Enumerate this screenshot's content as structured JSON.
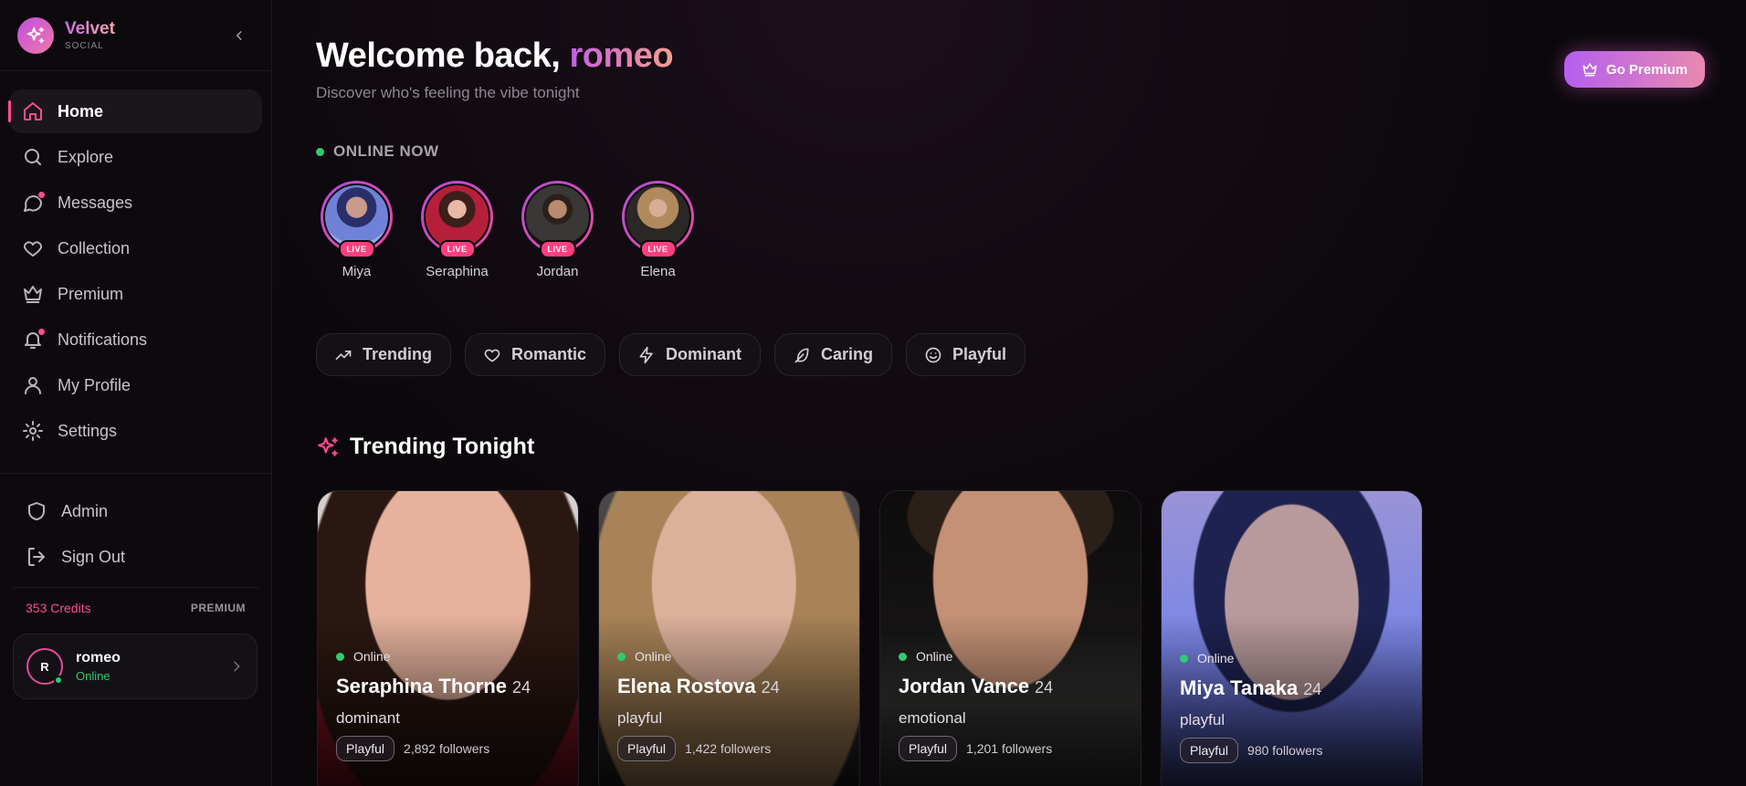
{
  "brand": {
    "name": "Velvet",
    "sub": "SOCIAL"
  },
  "nav": [
    {
      "label": "Home",
      "icon": "home-icon",
      "active": true
    },
    {
      "label": "Explore",
      "icon": "search-icon"
    },
    {
      "label": "Messages",
      "icon": "message-icon",
      "badge": true
    },
    {
      "label": "Collection",
      "icon": "heart-icon"
    },
    {
      "label": "Premium",
      "icon": "crown-icon"
    },
    {
      "label": "Notifications",
      "icon": "bell-icon",
      "badge": true
    },
    {
      "label": "My Profile",
      "icon": "user-icon"
    },
    {
      "label": "Settings",
      "icon": "gear-icon"
    }
  ],
  "nav_secondary": [
    {
      "label": "Admin",
      "icon": "shield-icon"
    },
    {
      "label": "Sign Out",
      "icon": "sign-out-icon"
    }
  ],
  "account": {
    "credits": "353 Credits",
    "tier": "PREMIUM",
    "initial": "R",
    "name": "romeo",
    "status": "Online"
  },
  "header": {
    "welcome": "Welcome back,",
    "username": "romeo",
    "subtitle": "Discover who's feeling the vibe tonight",
    "premium_button": "Go Premium"
  },
  "online_now": {
    "title": "ONLINE NOW",
    "live_label": "LIVE",
    "users": [
      {
        "name": "Miya"
      },
      {
        "name": "Seraphina"
      },
      {
        "name": "Jordan"
      },
      {
        "name": "Elena"
      }
    ]
  },
  "filters": [
    {
      "label": "Trending",
      "icon": "trending-icon"
    },
    {
      "label": "Romantic",
      "icon": "heart-icon"
    },
    {
      "label": "Dominant",
      "icon": "lightning-icon"
    },
    {
      "label": "Caring",
      "icon": "feather-icon"
    },
    {
      "label": "Playful",
      "icon": "smile-icon"
    }
  ],
  "trending": {
    "title": "Trending Tonight",
    "cards": [
      {
        "status": "Online",
        "name": "Seraphina Thorne",
        "age": "24",
        "mood": "dominant",
        "tag": "Playful",
        "followers": "2,892 followers"
      },
      {
        "status": "Online",
        "name": "Elena Rostova",
        "age": "24",
        "mood": "playful",
        "tag": "Playful",
        "followers": "1,422 followers"
      },
      {
        "status": "Online",
        "name": "Jordan Vance",
        "age": "24",
        "mood": "emotional",
        "tag": "Playful",
        "followers": "1,201 followers"
      },
      {
        "status": "Online",
        "name": "Miya Tanaka",
        "age": "24",
        "mood": "playful",
        "tag": "Playful",
        "followers": "980 followers"
      }
    ]
  },
  "colors": {
    "accent_pink": "#ff4d8d",
    "accent_purple": "#b55ff0",
    "online_green": "#2ecc71",
    "background": "#0b080c"
  }
}
